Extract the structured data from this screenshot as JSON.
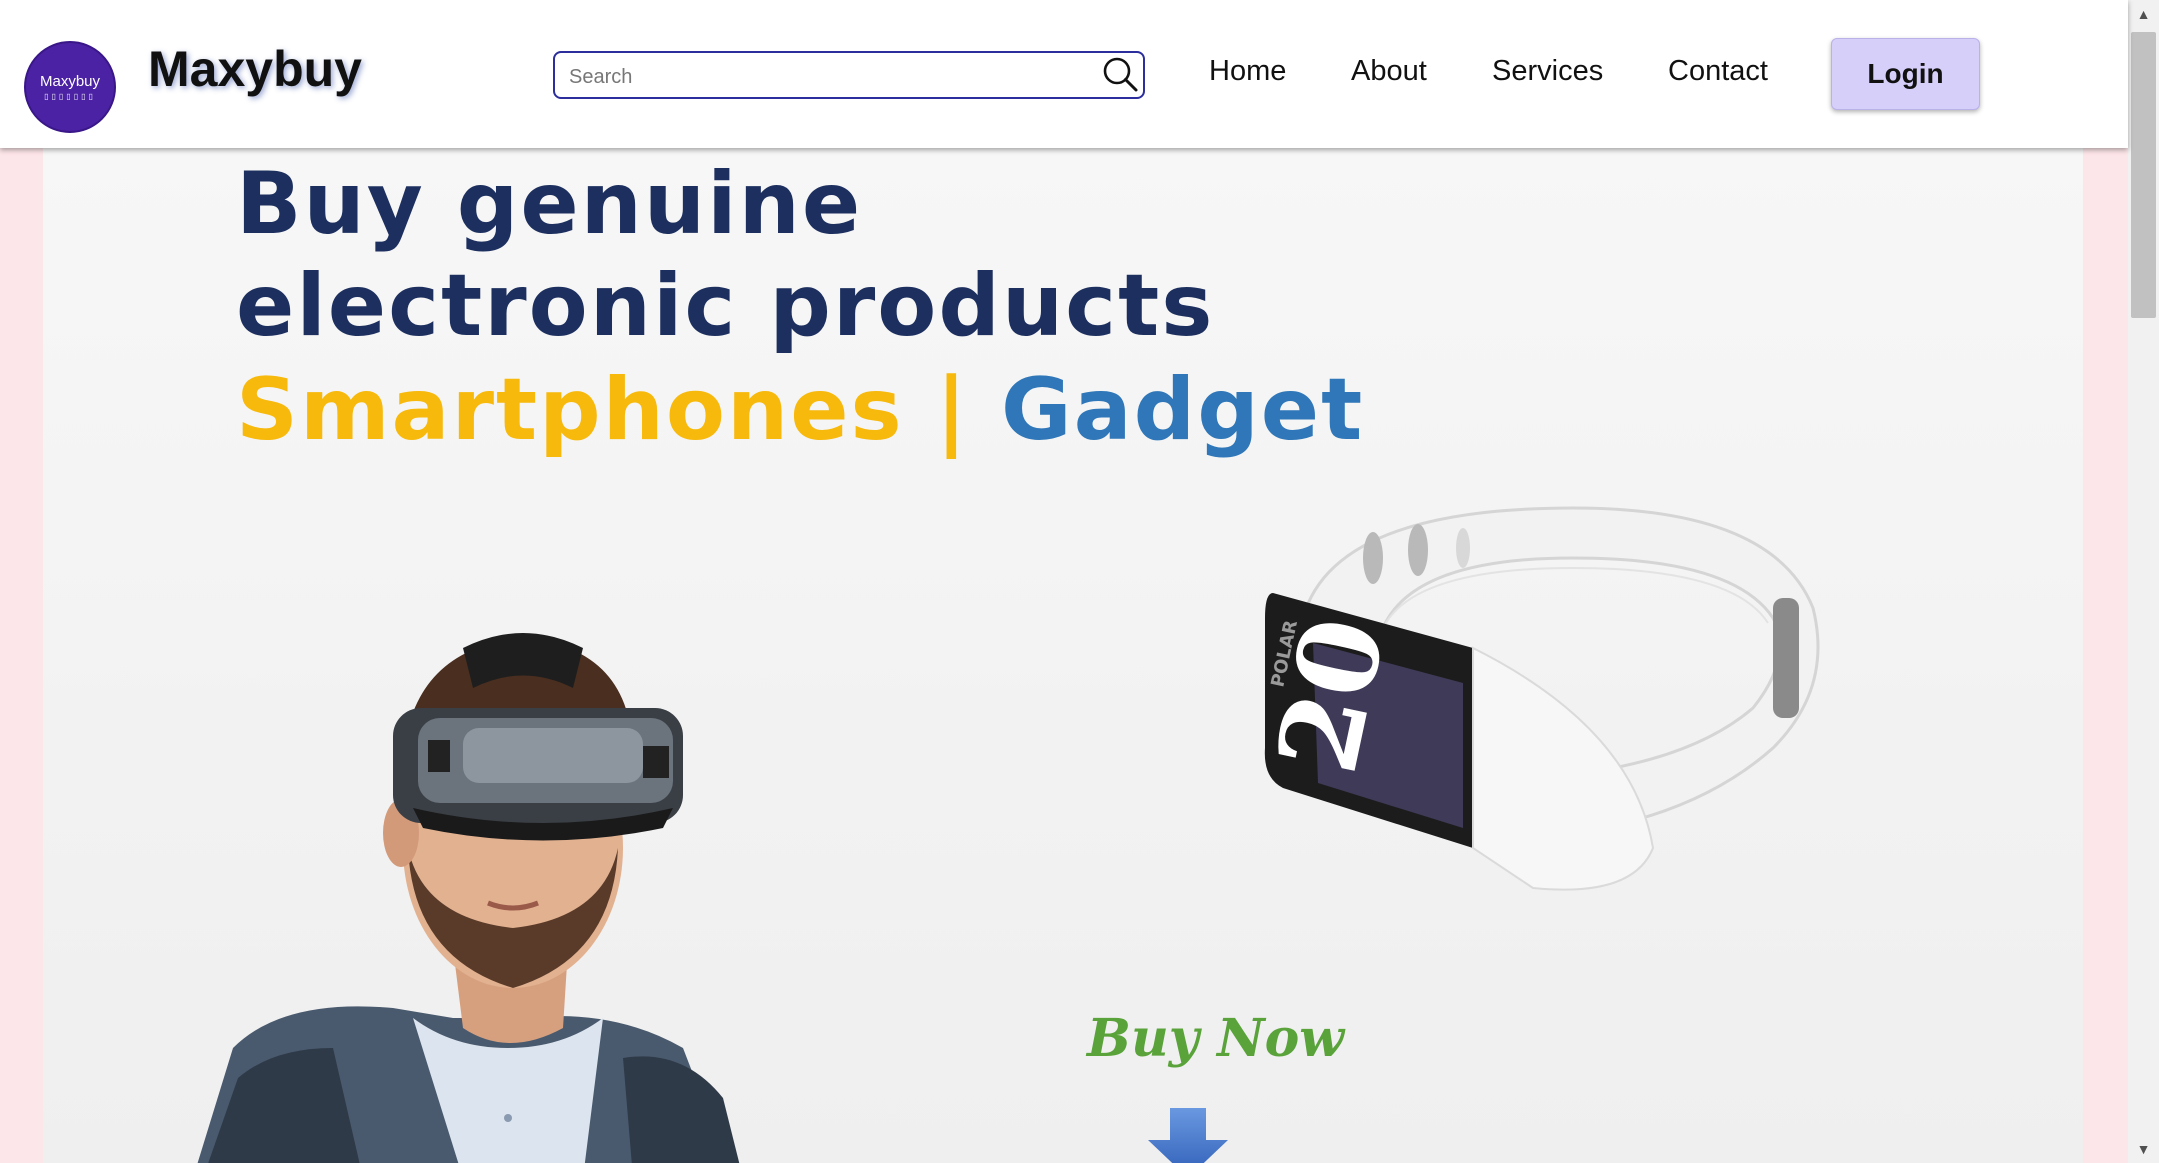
{
  "header": {
    "logo_text": "Maxybuy",
    "logo_subtext": "▯▯▯▯▯▯▯",
    "brand": "Maxybuy",
    "search_placeholder": "Search",
    "nav": [
      {
        "label": "Home"
      },
      {
        "label": "About"
      },
      {
        "label": "Services"
      },
      {
        "label": "Contact"
      }
    ],
    "login_label": "Login"
  },
  "hero": {
    "line1": "Buy genuine",
    "line2": "electronic products",
    "line3_part1": "Smartphones",
    "line3_separator": "|",
    "line3_part2": "Gadget",
    "band_brand": "POLAR",
    "band_time": "20",
    "cta": "Buy Now"
  },
  "colors": {
    "accent_purple": "#4a22a3",
    "login_bg": "#d6cffa",
    "headline_navy": "#1c2f5e",
    "highlight_yellow": "#f7b90c",
    "highlight_blue": "#2f77b8",
    "cta_green": "#5aa33a",
    "page_bg": "#fde6e9"
  },
  "icons": {
    "search": "search-icon",
    "scroll_up": "scroll-up-arrow-icon",
    "scroll_down": "scroll-down-arrow-icon",
    "cta_arrow": "down-arrow-icon"
  }
}
